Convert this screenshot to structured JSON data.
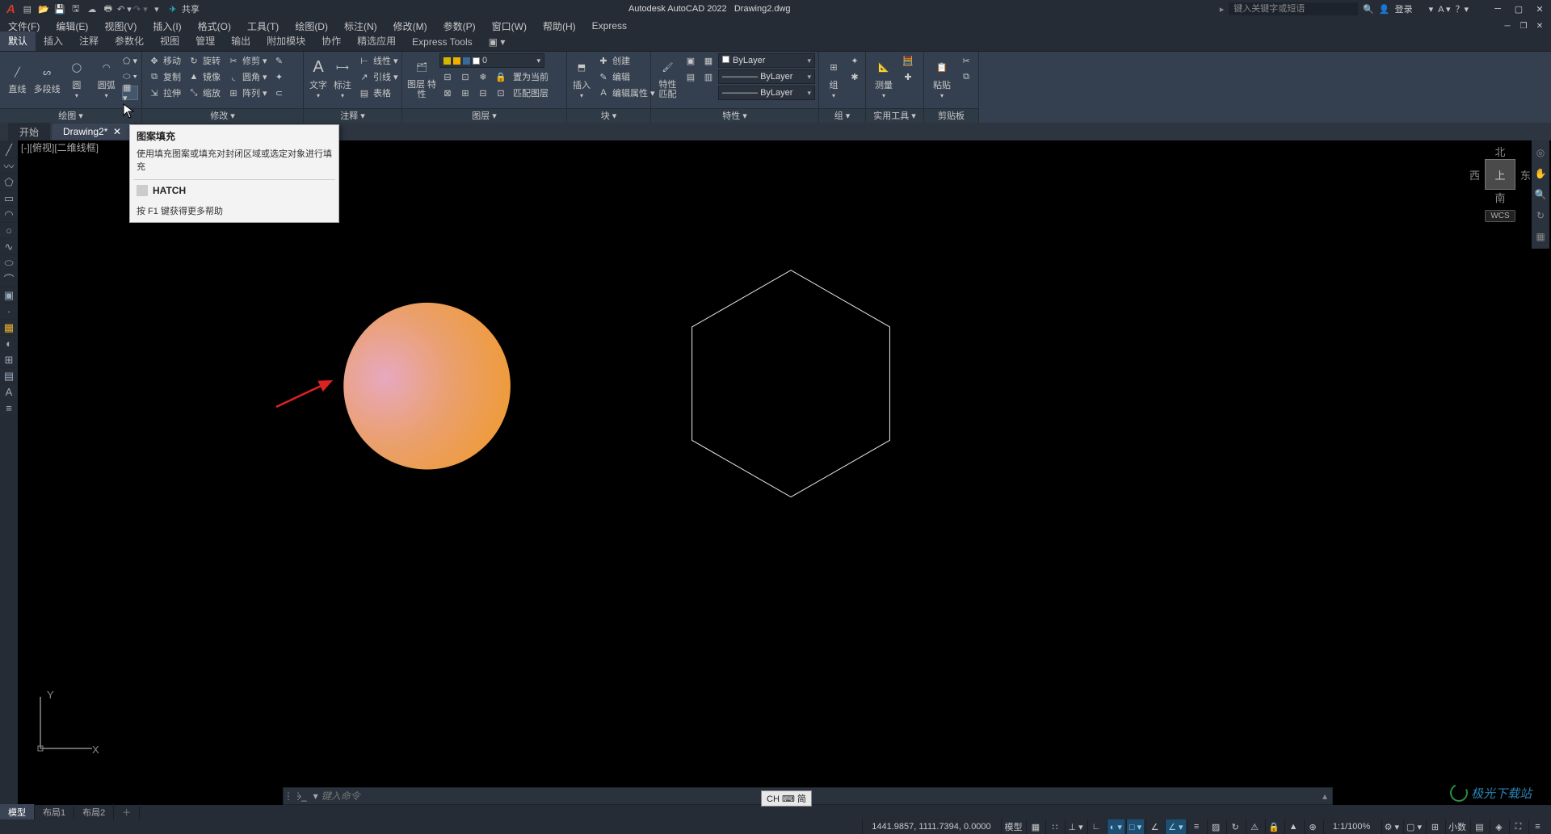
{
  "title": {
    "app": "Autodesk AutoCAD 2022",
    "doc": "Drawing2.dwg",
    "share": "共享",
    "search_ph": "键入关键字或短语",
    "login": "登录"
  },
  "menubar": [
    "文件(F)",
    "编辑(E)",
    "视图(V)",
    "插入(I)",
    "格式(O)",
    "工具(T)",
    "绘图(D)",
    "标注(N)",
    "修改(M)",
    "参数(P)",
    "窗口(W)",
    "帮助(H)",
    "Express"
  ],
  "ribbonTabs": [
    "默认",
    "插入",
    "注释",
    "参数化",
    "视图",
    "管理",
    "输出",
    "附加模块",
    "协作",
    "精选应用",
    "Express Tools"
  ],
  "drawPanel": {
    "line": "直线",
    "pline": "多段线",
    "circle": "圆",
    "arc": "圆弧",
    "title": "绘图 ▾"
  },
  "modifyPanel": {
    "move": "移动",
    "rotate": "旋转",
    "trim": "修剪",
    "copy": "复制",
    "mirror": "镜像",
    "fillet": "圆角",
    "stretch": "拉伸",
    "scale": "缩放",
    "array": "阵列",
    "title": "修改 ▾"
  },
  "annoPanel": {
    "text": "文字",
    "dim": "标注",
    "linear": "线性",
    "leader": "引线",
    "table": "表格",
    "title": "注释 ▾"
  },
  "layerPanel": {
    "props": "图层\n特性",
    "current": "置为当前",
    "match": "匹配图层",
    "sel": "0",
    "title": "图层 ▾"
  },
  "blockPanel": {
    "insert": "插入",
    "create": "创建",
    "edit": "编辑",
    "editattr": "编辑属性",
    "title": "块 ▾"
  },
  "propPanel": {
    "match": "特性\n匹配",
    "bylayer": "ByLayer",
    "title": "特性 ▾"
  },
  "groupPanel": {
    "group": "组",
    "title": "组 ▾"
  },
  "utilPanel": {
    "measure": "测量",
    "title": "实用工具 ▾"
  },
  "clipPanel": {
    "paste": "粘贴",
    "title": "剪贴板"
  },
  "filetabs": {
    "start": "开始",
    "drawing": "Drawing2*"
  },
  "viewport": {
    "label": "[-][俯视][二维线框]"
  },
  "compass": {
    "n": "北",
    "e": "东",
    "s": "南",
    "w": "西",
    "top": "上",
    "wcs": "WCS"
  },
  "tooltip": {
    "title": "图案填充",
    "desc": "使用填充图案或填充对封闭区域或选定对象进行填充",
    "cmd": "HATCH",
    "f1": "按 F1 键获得更多帮助"
  },
  "cmd": {
    "placeholder": "键入命令"
  },
  "ime": {
    "text": "CH ⌨ 简"
  },
  "layouttabs": {
    "model": "模型",
    "l1": "布局1",
    "l2": "布局2"
  },
  "statusbar": {
    "coords": "1441.9857, 1111.7394, 0.0000",
    "model": "模型",
    "scale": "1:1/100%",
    "dec": "小数"
  },
  "watermark": "极光下载站"
}
